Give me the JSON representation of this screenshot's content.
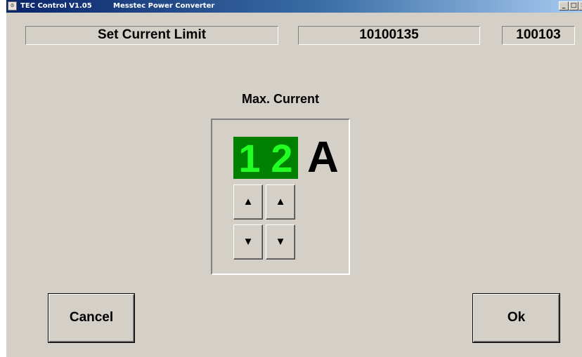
{
  "window": {
    "title": "TEC Control V1.05",
    "subtitle": "Messtec Power Converter",
    "icon": "tec-app-icon",
    "caption_buttons": {
      "minimize": "_",
      "maximize": "□",
      "close": "×"
    }
  },
  "header": {
    "title": "Set Current Limit",
    "serial": "10100135",
    "code": "100103"
  },
  "main": {
    "label": "Max. Current",
    "digits": [
      "1",
      "2"
    ],
    "unit": "A",
    "up_arrow": "▲",
    "down_arrow": "▼"
  },
  "footer": {
    "cancel_label": "Cancel",
    "ok_label": "Ok"
  },
  "colors": {
    "window_bg": "#d4d0c8",
    "digit_bg": "#008000",
    "digit_fg": "#22ff22",
    "titlebar": "#0a246a"
  }
}
